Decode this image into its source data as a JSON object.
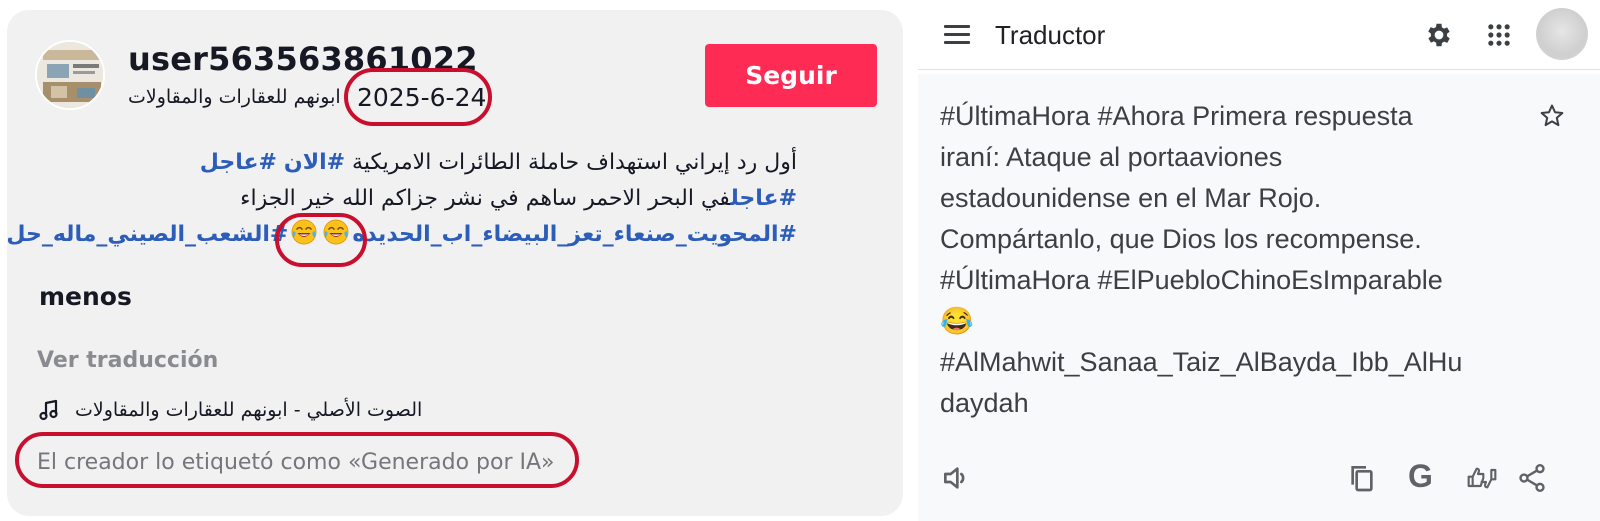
{
  "post": {
    "username": "user563563861022",
    "author_subtitle": "ابونهم للعقارات والمقاولات",
    "date": "2025-6-24",
    "follow_label": "Seguir",
    "caption_lines": [
      [
        {
          "text": "أول رد إيراني استهداف حاملة الطائرات الامريكية ",
          "tag": false
        },
        {
          "text": "#الان",
          "tag": true
        },
        {
          "text": " ",
          "tag": false
        },
        {
          "text": "#عاجل",
          "tag": true
        }
      ],
      [
        {
          "text": "#عاجل",
          "tag": true
        },
        {
          "text": "في البحر الاحمر ساهم في نشر جزاكم الله خير الجزاء",
          "tag": false
        }
      ],
      [
        {
          "text": "#المحويت_صنعاء_تعز_البيضاء_اب_الحديده",
          "tag": true
        },
        {
          "emoji": "face-with-tears-of-joy"
        },
        {
          "emoji": "face-with-tears-of-joy"
        },
        {
          "text": "#الشعب_الصيني_ماله_حل",
          "tag": true
        }
      ]
    ],
    "less_label": "menos",
    "see_translation_label": "Ver traducción",
    "music_text": "الصوت الأصلي - ابونهم للعقارات والمقاولات",
    "ai_label": "El creador lo etiquetó como «Generado por IA»",
    "colors": {
      "follow": "#fe2c55",
      "hashtag": "#2b5db9",
      "annotation": "#c8102e",
      "card": "#f1f1f2"
    },
    "icons": {
      "music": "music-note-icon",
      "emoji": "face-with-tears-of-joy"
    }
  },
  "translator": {
    "title": "Traductor",
    "lines": [
      "#ÚltimaHora #Ahora Primera respuesta",
      "iraní: Ataque al portaaviones",
      "estadounidense en el Mar Rojo.",
      "Compártanlo, que Dios los recompense.",
      "#ÚltimaHora #ElPuebloChinoEsImparable",
      "😂",
      "#AlMahwit_Sanaa_Taiz_AlBayda_Ibb_AlHu",
      "daydah"
    ],
    "google_letter": "G",
    "icons": {
      "menu": "menu-icon",
      "settings": "gear-icon",
      "apps": "apps-grid-icon",
      "star": "star-icon",
      "listen": "speaker-icon",
      "copy": "copy-icon",
      "rate": "thumbs-icon",
      "share": "share-icon"
    }
  }
}
